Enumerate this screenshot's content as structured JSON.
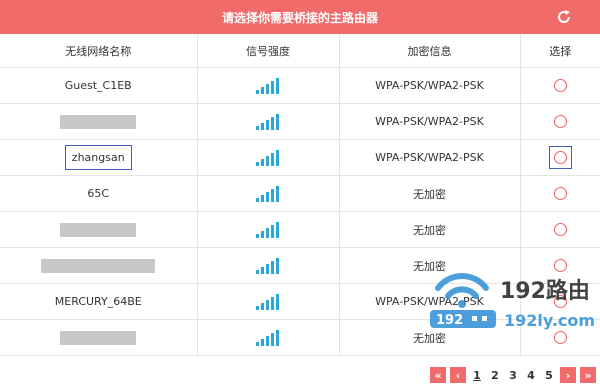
{
  "header": {
    "title": "请选择你需要桥接的主路由器",
    "refresh_icon": "refresh-icon"
  },
  "table": {
    "columns": [
      "无线网络名称",
      "信号强度",
      "加密信息",
      "选择"
    ],
    "rows": [
      {
        "ssid": "Guest_C1EB",
        "masked": false,
        "security": "WPA-PSK/WPA2-PSK"
      },
      {
        "ssid": "",
        "masked": true,
        "security": "WPA-PSK/WPA2-PSK"
      },
      {
        "ssid": "zhangsan",
        "masked": false,
        "focused": true,
        "security": "WPA-PSK/WPA2-PSK"
      },
      {
        "ssid": "65C",
        "masked": false,
        "security": "无加密"
      },
      {
        "ssid": "",
        "masked": true,
        "security": "无加密"
      },
      {
        "ssid": "",
        "masked": true,
        "security": "无加密"
      },
      {
        "ssid": "MERCURY_64BE",
        "masked": false,
        "security": "WPA-PSK/WPA2-PSK"
      },
      {
        "ssid": "",
        "masked": true,
        "security": "无加密"
      }
    ]
  },
  "watermark": {
    "brand": "192路由",
    "url": "192ly.com",
    "badge": "192"
  },
  "pagination": {
    "pages": [
      "1",
      "2",
      "3",
      "4",
      "5"
    ],
    "current": "1"
  },
  "colors": {
    "accent": "#f26b6b",
    "focus": "#3d5fb8",
    "signal": "#2aa6d9"
  }
}
